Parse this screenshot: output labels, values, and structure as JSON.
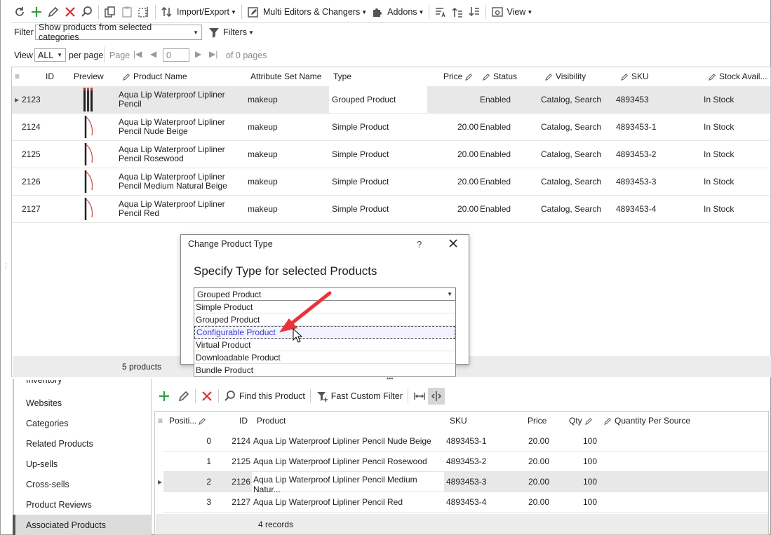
{
  "toolbar": {
    "import_export": "Import/Export",
    "multi_editors": "Multi Editors & Changers",
    "addons": "Addons",
    "view": "View"
  },
  "filter": {
    "label": "Filter",
    "value": "Show products from selected categories",
    "filters_label": "Filters"
  },
  "paging": {
    "view_label": "View",
    "per_page_value": "ALL",
    "per_page_label": "per page",
    "page_label": "Page",
    "page_value": "0",
    "of_pages": "of 0 pages"
  },
  "grid": {
    "columns": [
      "ID",
      "Preview",
      "Product Name",
      "Attribute Set Name",
      "Type",
      "Price",
      "Status",
      "Visibility",
      "SKU",
      "Stock Avail..."
    ],
    "rows": [
      {
        "id": "2123",
        "name1": "Aqua Lip Waterproof Lipliner",
        "name2": "Pencil",
        "attr": "makeup",
        "type": "Grouped Product",
        "price": "",
        "status": "Enabled",
        "visibility": "Catalog, Search",
        "sku": "4893453",
        "stock": "In Stock"
      },
      {
        "id": "2124",
        "name1": "Aqua Lip Waterproof Lipliner",
        "name2": "Pencil Nude Beige",
        "attr": "makeup",
        "type": "Simple Product",
        "price": "20.00",
        "status": "Enabled",
        "visibility": "Catalog, Search",
        "sku": "4893453-1",
        "stock": "In Stock"
      },
      {
        "id": "2125",
        "name1": "Aqua Lip Waterproof Lipliner",
        "name2": "Pencil Rosewood",
        "attr": "makeup",
        "type": "Simple Product",
        "price": "20.00",
        "status": "Enabled",
        "visibility": "Catalog, Search",
        "sku": "4893453-2",
        "stock": "In Stock"
      },
      {
        "id": "2126",
        "name1": "Aqua Lip Waterproof Lipliner",
        "name2": "Pencil Medium Natural Beige",
        "attr": "makeup",
        "type": "Simple Product",
        "price": "20.00",
        "status": "Enabled",
        "visibility": "Catalog, Search",
        "sku": "4893453-3",
        "stock": "In Stock"
      },
      {
        "id": "2127",
        "name1": "Aqua Lip Waterproof Lipliner",
        "name2": "Pencil Red",
        "attr": "makeup",
        "type": "Simple Product",
        "price": "20.00",
        "status": "Enabled",
        "visibility": "Catalog, Search",
        "sku": "4893453-4",
        "stock": "In Stock"
      }
    ],
    "footer_count": "5 products"
  },
  "dialog": {
    "title": "Change Product Type",
    "help": "?",
    "heading": "Specify Type for selected Products",
    "selected": "Grouped Product",
    "options": [
      "Simple Product",
      "Grouped Product",
      "Configurable Product",
      "Virtual Product",
      "Downloadable Product",
      "Bundle Product"
    ],
    "highlighted_index": 2
  },
  "left_nav": {
    "items": [
      "Inventory",
      "Websites",
      "Categories",
      "Related Products",
      "Up-sells",
      "Cross-sells",
      "Product Reviews",
      "Associated Products"
    ],
    "active_index": 7
  },
  "sub_toolbar": {
    "find_label": "Find this Product",
    "fast_filter_label": "Fast Custom Filter"
  },
  "sub_grid": {
    "columns": [
      "Positi...",
      "ID",
      "Product",
      "SKU",
      "Price",
      "Qty",
      "Quantity Per Source"
    ],
    "rows": [
      {
        "pos": "0",
        "id": "2124",
        "product": "Aqua Lip Waterproof Lipliner Pencil Nude Beige",
        "sku": "4893453-1",
        "price": "20.00",
        "qty": "100"
      },
      {
        "pos": "1",
        "id": "2125",
        "product": "Aqua Lip Waterproof Lipliner Pencil Rosewood",
        "sku": "4893453-2",
        "price": "20.00",
        "qty": "100"
      },
      {
        "pos": "2",
        "id": "2126",
        "product": "Aqua Lip Waterproof Lipliner Pencil Medium Natur...",
        "sku": "4893453-3",
        "price": "20.00",
        "qty": "100"
      },
      {
        "pos": "3",
        "id": "2127",
        "product": "Aqua Lip Waterproof Lipliner Pencil Red",
        "sku": "4893453-4",
        "price": "20.00",
        "qty": "100"
      }
    ],
    "footer_count": "4 records"
  },
  "colors": {
    "add_green": "#2e9e3e",
    "delete_red": "#d9262c",
    "arrow_red": "#e8353b",
    "row_selected": "#e8e8e8",
    "nav_active": "#dcdcdc"
  }
}
